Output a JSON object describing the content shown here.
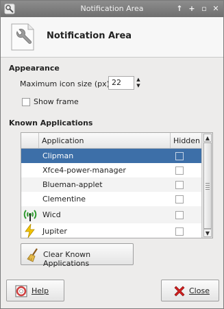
{
  "window": {
    "title": "Notification Area"
  },
  "titlebar_buttons": {
    "up": "↑",
    "plus": "+",
    "maximize": "▫",
    "close": "✕"
  },
  "header": {
    "title": "Notification Area"
  },
  "appearance": {
    "section_title": "Appearance",
    "max_icon_size_label": "Maximum icon size (px):",
    "max_icon_size_value": "22",
    "show_frame_label": "Show frame"
  },
  "known_apps": {
    "section_title": "Known Applications",
    "columns": {
      "application": "Application",
      "hidden": "Hidden"
    },
    "rows": [
      {
        "name": "Clipman",
        "hidden": false,
        "selected": true,
        "icon": ""
      },
      {
        "name": "Xfce4-power-manager",
        "hidden": false,
        "selected": false,
        "icon": ""
      },
      {
        "name": "Blueman-applet",
        "hidden": false,
        "selected": false,
        "icon": ""
      },
      {
        "name": "Clementine",
        "hidden": false,
        "selected": false,
        "icon": ""
      },
      {
        "name": "Wicd",
        "hidden": false,
        "selected": false,
        "icon": "wifi-antenna-icon"
      },
      {
        "name": "Jupiter",
        "hidden": false,
        "selected": false,
        "icon": "lightning-icon"
      }
    ],
    "clear_button_label": "Clear Known Applications"
  },
  "footer": {
    "help_label": "Help",
    "close_label": "Close"
  },
  "colors": {
    "selection": "#3d6fa8",
    "titlebar": "#7f7f7f"
  }
}
